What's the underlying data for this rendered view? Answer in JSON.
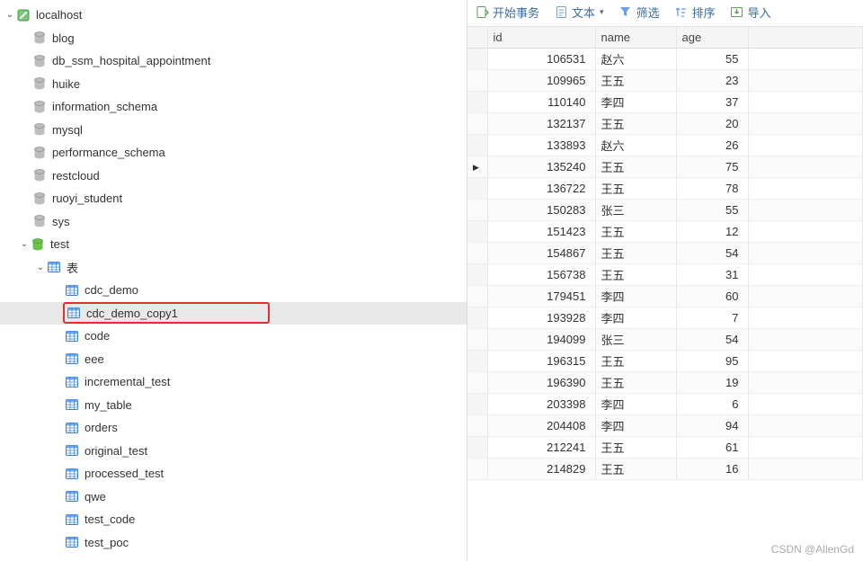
{
  "connection": {
    "name": "localhost"
  },
  "databases": [
    {
      "label": "blog"
    },
    {
      "label": "db_ssm_hospital_appointment"
    },
    {
      "label": "huike"
    },
    {
      "label": "information_schema"
    },
    {
      "label": "mysql"
    },
    {
      "label": "performance_schema"
    },
    {
      "label": "restcloud"
    },
    {
      "label": "ruoyi_student"
    },
    {
      "label": "sys"
    }
  ],
  "open_db": {
    "label": "test",
    "tables_node": "表",
    "tables": [
      {
        "label": "cdc_demo"
      },
      {
        "label": "cdc_demo_copy1",
        "selected": true,
        "highlight": true
      },
      {
        "label": "code"
      },
      {
        "label": "eee"
      },
      {
        "label": "incremental_test"
      },
      {
        "label": "my_table"
      },
      {
        "label": "orders"
      },
      {
        "label": "original_test"
      },
      {
        "label": "processed_test"
      },
      {
        "label": "qwe"
      },
      {
        "label": "test_code"
      },
      {
        "label": "test_poc"
      }
    ]
  },
  "toolbar": {
    "begin_tx": "开始事务",
    "text": "文本",
    "filter": "筛选",
    "sort": "排序",
    "import": "导入"
  },
  "columns": {
    "id": "id",
    "name": "name",
    "age": "age"
  },
  "rows": [
    {
      "id": 106531,
      "name": "赵六",
      "age": 55
    },
    {
      "id": 109965,
      "name": "王五",
      "age": 23
    },
    {
      "id": 110140,
      "name": "李四",
      "age": 37
    },
    {
      "id": 132137,
      "name": "王五",
      "age": 20
    },
    {
      "id": 133893,
      "name": "赵六",
      "age": 26
    },
    {
      "id": 135240,
      "name": "王五",
      "age": 75,
      "pointer": true
    },
    {
      "id": 136722,
      "name": "王五",
      "age": 78
    },
    {
      "id": 150283,
      "name": "张三",
      "age": 55
    },
    {
      "id": 151423,
      "name": "王五",
      "age": 12
    },
    {
      "id": 154867,
      "name": "王五",
      "age": 54
    },
    {
      "id": 156738,
      "name": "王五",
      "age": 31
    },
    {
      "id": 179451,
      "name": "李四",
      "age": 60
    },
    {
      "id": 193928,
      "name": "李四",
      "age": 7
    },
    {
      "id": 194099,
      "name": "张三",
      "age": 54
    },
    {
      "id": 196315,
      "name": "王五",
      "age": 95
    },
    {
      "id": 196390,
      "name": "王五",
      "age": 19
    },
    {
      "id": 203398,
      "name": "李四",
      "age": 6
    },
    {
      "id": 204408,
      "name": "李四",
      "age": 94
    },
    {
      "id": 212241,
      "name": "王五",
      "age": 61
    },
    {
      "id": 214829,
      "name": "王五",
      "age": 16
    }
  ],
  "watermark": "CSDN @AllenGd"
}
